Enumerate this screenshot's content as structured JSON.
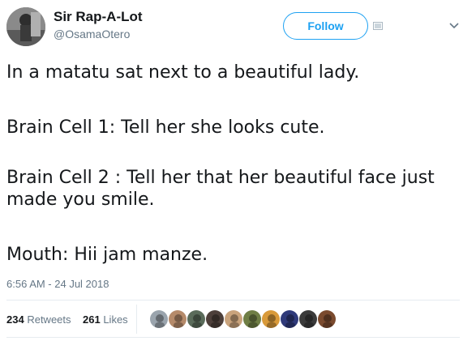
{
  "user": {
    "display_name": "Sir Rap-A-Lot",
    "handle": "@OsamaOtero"
  },
  "follow_label": "Follow",
  "tweet": {
    "lines": [
      "In a matatu sat next to a beautiful lady.",
      "Brain Cell 1: Tell her she looks cute.",
      "Brain Cell 2 : Tell her that her beautiful face just made you smile.",
      "Mouth: Hii jam manze."
    ],
    "timestamp": "6:56 AM - 24 Jul 2018"
  },
  "stats": {
    "retweets_count": "234",
    "retweets_label": "Retweets",
    "likes_count": "261",
    "likes_label": "Likes"
  },
  "icons": {
    "translate": "translate-icon",
    "more": "chevron-down-icon"
  },
  "colors": {
    "accent": "#1da1f2",
    "secondary_text": "#657786",
    "divider": "#e6ecf0"
  },
  "liker_avatars": [
    {
      "color": "#9aa4ad"
    },
    {
      "color": "#b58a6a"
    },
    {
      "color": "#5a6b5a"
    },
    {
      "color": "#4d3f3a"
    },
    {
      "color": "#c9a37c"
    },
    {
      "color": "#6f7e45"
    },
    {
      "color": "#d99a3a"
    },
    {
      "color": "#2f3a7a"
    },
    {
      "color": "#3b3b3b"
    },
    {
      "color": "#7a4a2e"
    }
  ]
}
